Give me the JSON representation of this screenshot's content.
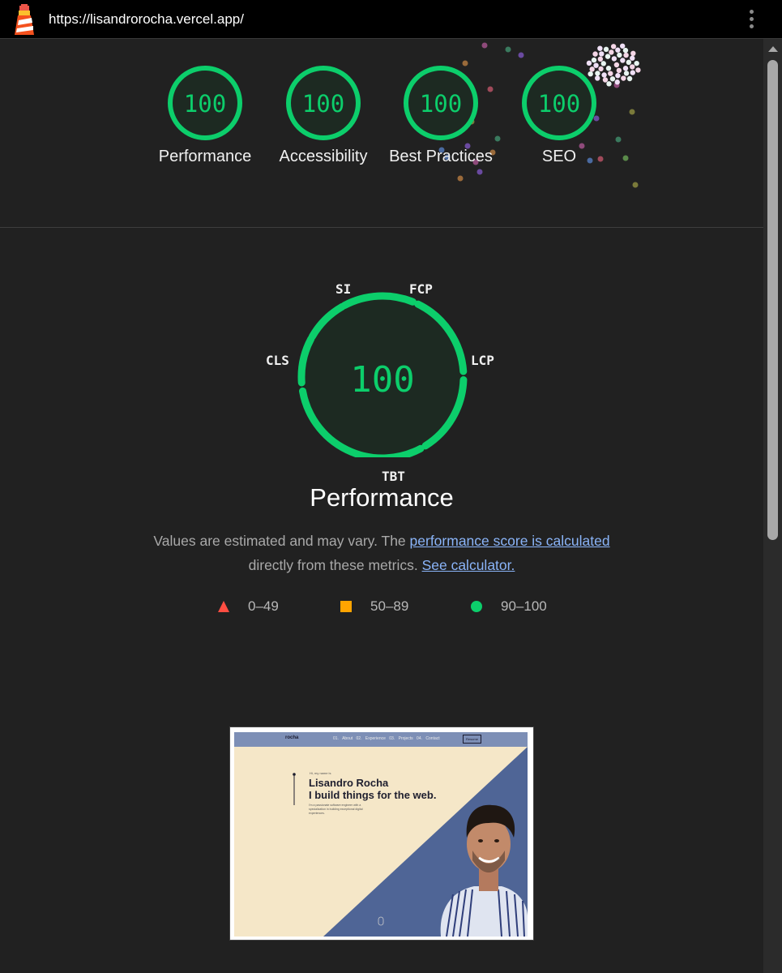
{
  "browser": {
    "url": "https://lisandrorocha.vercel.app/",
    "menu_icon": "more-vert-icon"
  },
  "colors": {
    "pass": "#0cce6b",
    "average": "#ffa400",
    "fail": "#ff4e42",
    "link": "#8ab4f8"
  },
  "summary": {
    "categories": [
      {
        "label": "Performance",
        "score": "100"
      },
      {
        "label": "Accessibility",
        "score": "100"
      },
      {
        "label": "Best Practices",
        "score": "100"
      },
      {
        "label": "SEO",
        "score": "100"
      }
    ]
  },
  "performance": {
    "score": "100",
    "title": "Performance",
    "metrics": {
      "si": "SI",
      "fcp": "FCP",
      "lcp": "LCP",
      "tbt": "TBT",
      "cls": "CLS"
    },
    "description_prefix": "Values are estimated and may vary. The ",
    "score_link": "performance score is calculated",
    "description_middle": " directly from these metrics. ",
    "calculator_link": "See calculator."
  },
  "legend": [
    {
      "range": "0–49",
      "shape": "triangle"
    },
    {
      "range": "50–89",
      "shape": "square"
    },
    {
      "range": "90–100",
      "shape": "circle"
    }
  ],
  "screenshot": {
    "brand": "rocha",
    "nav_links": "01. About 02. Experience 03. Projects 04. Contact",
    "resume_button": "Resume",
    "greeting": "Hi, my name is",
    "name": "Lisandro Rocha",
    "tagline": "I build things for the web.",
    "blurb": "I'm a passionate software engineer with a specialization in building exceptional digital experiences."
  }
}
